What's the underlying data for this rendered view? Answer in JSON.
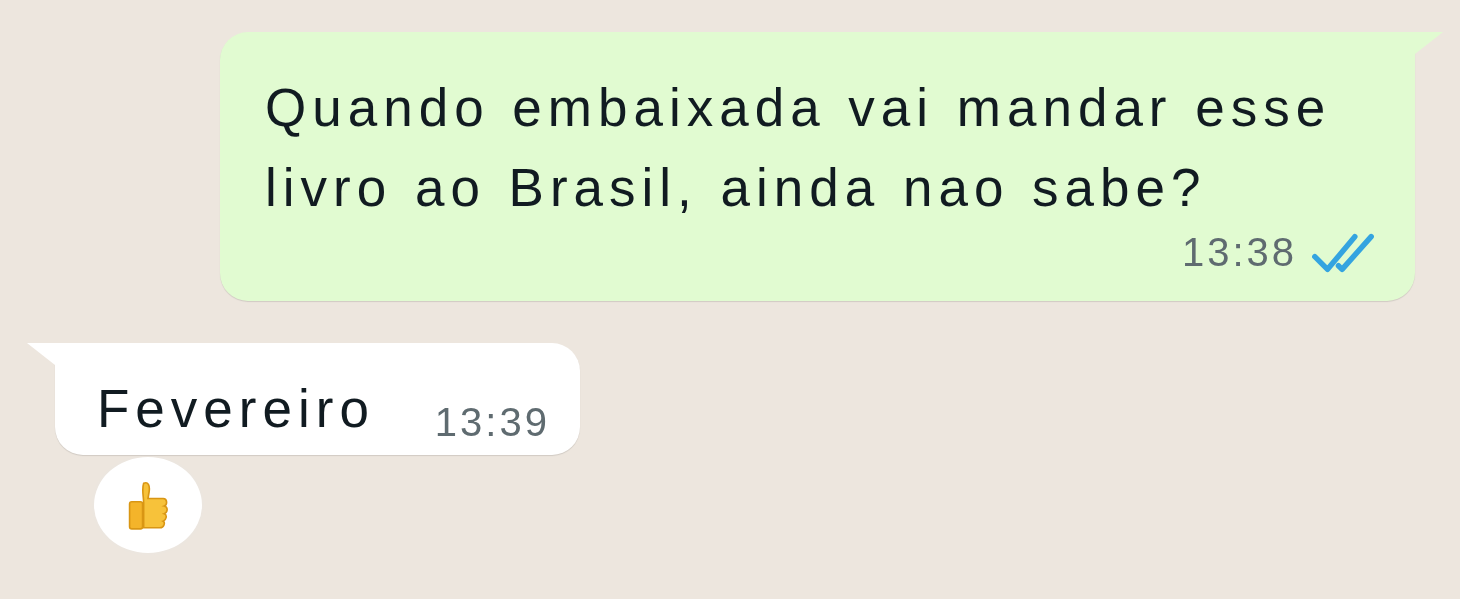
{
  "messages": [
    {
      "kind": "outgoing",
      "text": "Quando embaixada vai mandar esse livro ao Brasil, ainda nao sabe?",
      "time": "13:38",
      "read": true
    },
    {
      "kind": "incoming",
      "text": "Fevereiro",
      "time": "13:39",
      "reactions": [
        {
          "kind": "thumbs_up"
        }
      ]
    }
  ]
}
